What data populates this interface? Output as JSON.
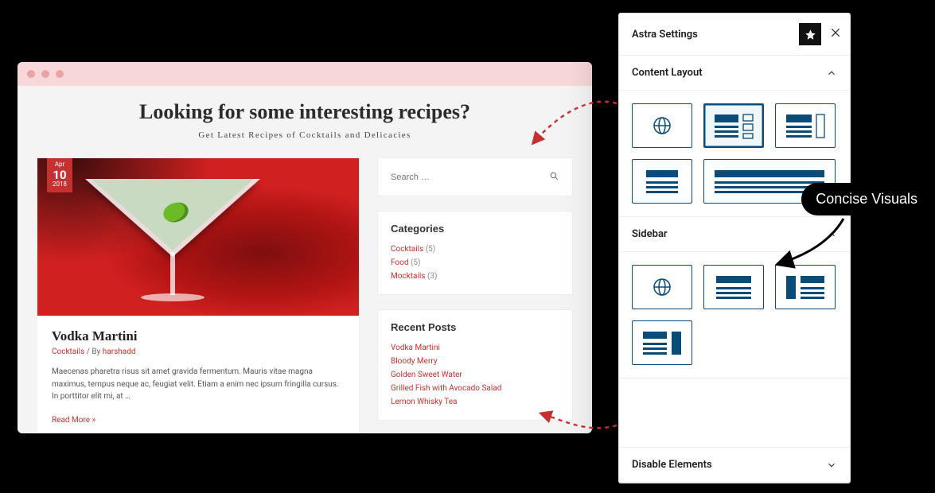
{
  "page": {
    "heading": "Looking for some interesting recipes?",
    "subheading": "Get Latest Recipes of Cocktails and Delicacies"
  },
  "post": {
    "date": {
      "month": "Apr",
      "day": "10",
      "year": "2018"
    },
    "title": "Vodka Martini",
    "category": "Cocktails",
    "by_sep": " / By ",
    "author": "harshadd",
    "excerpt": "Maecenas pharetra risus sit amet gravida fermentum. Mauris vitae magna maximus, tempus neque ac, feugiat velit. Etiam a enim nec ipsum fringilla cursus. In porttitor elit mi, at …",
    "read_more": "Read More »"
  },
  "search": {
    "placeholder": "Search …"
  },
  "categories": {
    "title": "Categories",
    "items": [
      {
        "name": "Cocktails",
        "count": "(5)"
      },
      {
        "name": "Food",
        "count": "(5)"
      },
      {
        "name": "Mocktails",
        "count": "(3)"
      }
    ]
  },
  "recent": {
    "title": "Recent Posts",
    "items": [
      "Vodka Martini",
      "Bloody Merry",
      "Golden Sweet Water",
      "Grilled Fish with Avocado Salad",
      "Lemon Whisky Tea"
    ]
  },
  "panel": {
    "title": "Astra Settings",
    "sections": {
      "content_layout": "Content Layout",
      "sidebar": "Sidebar",
      "disable_elements": "Disable Elements"
    }
  },
  "annotation": {
    "label": "Concise Visuals"
  },
  "colors": {
    "accent": "#c53030",
    "panel_blue": "#0a4b78"
  }
}
